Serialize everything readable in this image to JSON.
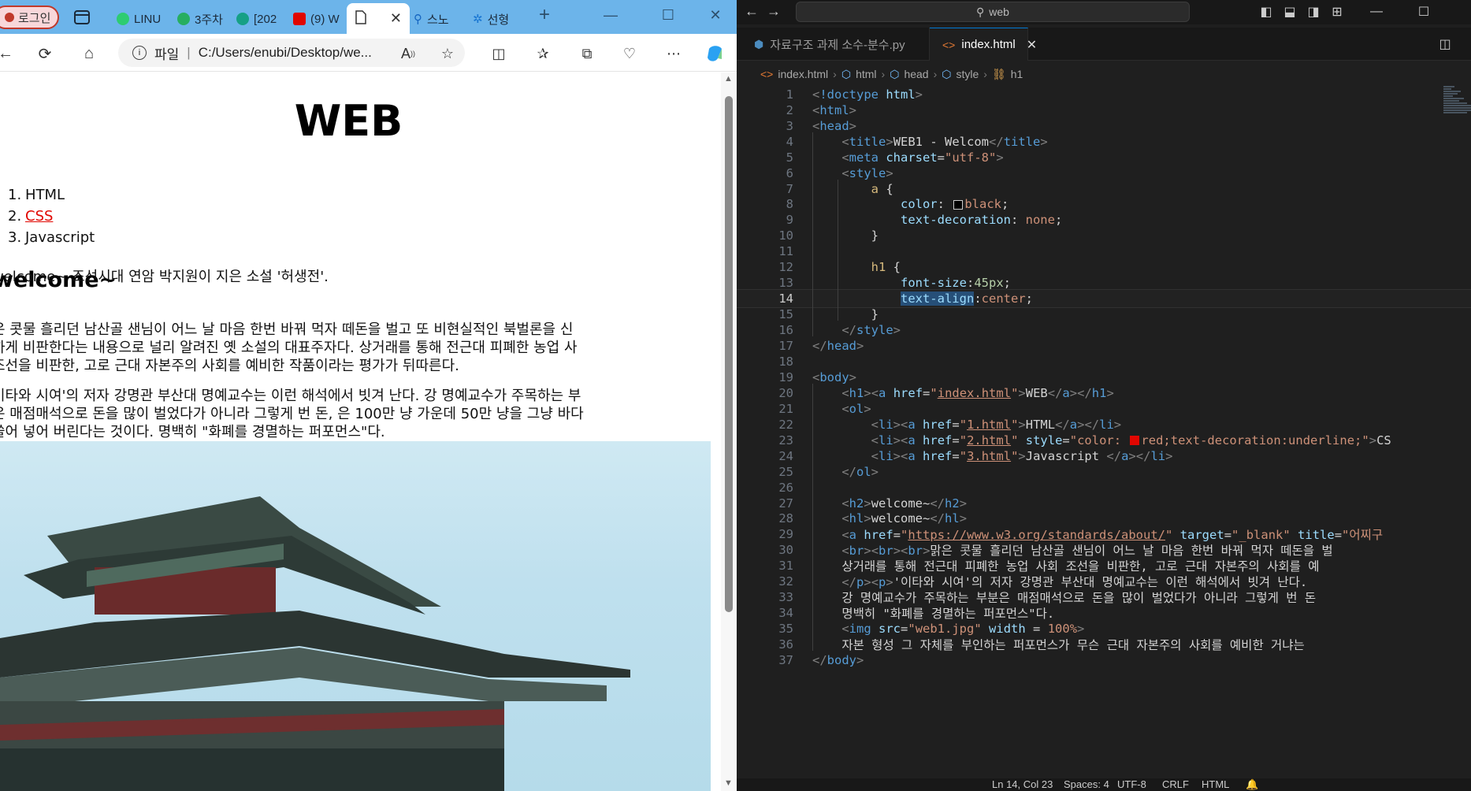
{
  "browser": {
    "login_label": "로그인",
    "tabs": [
      {
        "label": "LINU",
        "color": "#2ecc71"
      },
      {
        "label": "3주차",
        "color": "#27ae60"
      },
      {
        "label": "[202",
        "color": "#16a085"
      },
      {
        "label": "(9) W",
        "color": "#e10600"
      },
      {
        "label": "",
        "color": "#666666"
      },
      {
        "label": "스노",
        "color": "#1565c0"
      },
      {
        "label": "선형",
        "color": "#1976d2"
      }
    ],
    "address": {
      "scheme_label": "파일",
      "url": "C:/Users/enubi/Desktop/we..."
    },
    "page": {
      "h1": "WEB",
      "list": [
        {
          "num": "1.",
          "label": "HTML"
        },
        {
          "num": "2.",
          "label": "CSS"
        },
        {
          "num": "3.",
          "label": "Javascript"
        }
      ],
      "h2": "welcome~",
      "p1": "welcome~ 조선시대 연암 박지원이 지은 소설 '허생전'.",
      "p2": [
        "은 콧물 흘리던 남산골 샌님이 어느 날 마음 한번 바꿔 먹자 떼돈을 벌고 또 비현실적인 북벌론을 신",
        "하게 비판한다는 내용으로 널리 알려진 옛 소설의 대표주자다. 상거래를 통해 전근대 피폐한 농업 사",
        "조선을 비판한, 고로 근대 자본주의 사회를 예비한 작품이라는 평가가 뒤따른다."
      ],
      "p3": [
        "이타와 시여'의 저자 강명관 부산대 명예교수는 이런 해석에서 빗겨 난다. 강 명예교수가 주목하는 부",
        "은 매점매석으로 돈을 많이 벌었다가 아니라 그렇게 번 돈, 은 100만 냥 가운데 50만 냥을 그냥 바다",
        "쓸어 넣어 버린다는 것이다. 명백히 \"화폐를 경멸하는 퍼포먼스\"다."
      ]
    }
  },
  "vscode": {
    "search_label": "web",
    "tabs": [
      {
        "label": "자료구조 과제 소수-분수.py",
        "active": false
      },
      {
        "label": "index.html",
        "active": true
      }
    ],
    "breadcrumb": [
      "index.html",
      "html",
      "head",
      "style",
      "h1"
    ],
    "status": {
      "position": "Ln 14, Col 23",
      "spaces": "Spaces: 4",
      "encoding": "UTF-8",
      "eol": "CRLF",
      "language": "HTML"
    },
    "current_line": 14,
    "swatch_colors": {
      "black": "#000000",
      "red": "#e10600"
    },
    "lines": [
      {
        "n": "1",
        "text": "<!doctype html>"
      },
      {
        "n": "2",
        "text": "<html>"
      },
      {
        "n": "3",
        "text": "<head>"
      },
      {
        "n": "4",
        "text": "    <title>WEB1 - Welcom</title>"
      },
      {
        "n": "5",
        "text": "    <meta charset=\"utf-8\">"
      },
      {
        "n": "6",
        "text": "    <style>"
      },
      {
        "n": "7",
        "text": "        a {"
      },
      {
        "n": "8",
        "text": "            color: black;"
      },
      {
        "n": "9",
        "text": "            text-decoration: none;"
      },
      {
        "n": "10",
        "text": "        }"
      },
      {
        "n": "11",
        "text": ""
      },
      {
        "n": "12",
        "text": "        h1 {"
      },
      {
        "n": "13",
        "text": "            font-size:45px;"
      },
      {
        "n": "14",
        "text": "            text-align:center;"
      },
      {
        "n": "15",
        "text": "        }"
      },
      {
        "n": "16",
        "text": "    </style>"
      },
      {
        "n": "17",
        "text": "</head>"
      },
      {
        "n": "18",
        "text": ""
      },
      {
        "n": "19",
        "text": "<body>"
      },
      {
        "n": "20",
        "text": "    <h1><a href=\"index.html\">WEB</a></h1>"
      },
      {
        "n": "21",
        "text": "    <ol>"
      },
      {
        "n": "22",
        "text": "        <li><a href=\"1.html\">HTML</a></li>"
      },
      {
        "n": "23",
        "text": "        <li><a href=\"2.html\" style=\"color: red;text-decoration:underline;\">CS"
      },
      {
        "n": "24",
        "text": "        <li><a href=\"3.html\">Javascript </a></li>"
      },
      {
        "n": "25",
        "text": "    </ol>"
      },
      {
        "n": "26",
        "text": ""
      },
      {
        "n": "27",
        "text": "    <h2>welcome~</h2>"
      },
      {
        "n": "28",
        "text": "    <hl>welcome~</hl>"
      },
      {
        "n": "29",
        "text": "    <a href=\"https://www.w3.org/standards/about/\" target=\"_blank\" title=\"어찌구"
      },
      {
        "n": "30",
        "text": "    <br><br><br>맑은 콧물 흘리던 남산골 샌님이 어느 날 마음 한번 바꿔 먹자 떼돈을 벌"
      },
      {
        "n": "31",
        "text": "    상거래를 통해 전근대 피폐한 농업 사회 조선을 비판한, 고로 근대 자본주의 사회를 예"
      },
      {
        "n": "32",
        "text": "    </p><p>'이타와 시여'의 저자 강명관 부산대 명예교수는 이런 해석에서 빗겨 난다."
      },
      {
        "n": "33",
        "text": "    강 명예교수가 주목하는 부분은 매점매석으로 돈을 많이 벌었다가 아니라 그렇게 번 돈"
      },
      {
        "n": "34",
        "text": "    명백히 \"화폐를 경멸하는 퍼포먼스\"다."
      },
      {
        "n": "35",
        "text": "    <img src=\"web1.jpg\" width = 100%>"
      },
      {
        "n": "36",
        "text": "    자본 형성 그 자체를 부인하는 퍼포먼스가 무슨 근대 자본주의 사회를 예비한 거냐는"
      },
      {
        "n": "37",
        "text": "</body>"
      }
    ]
  }
}
